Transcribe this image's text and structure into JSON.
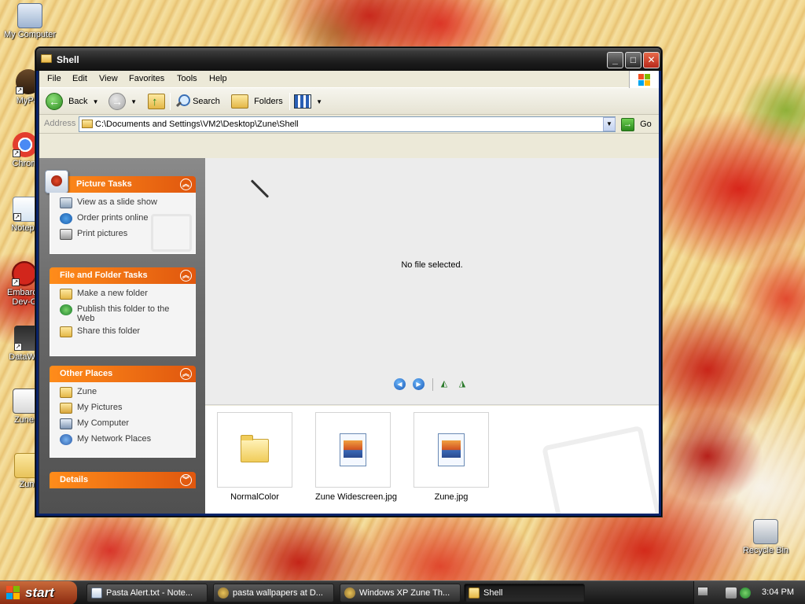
{
  "desktop": {
    "icons": [
      {
        "label": "My Computer"
      },
      {
        "label": "MyPal"
      },
      {
        "label": "Chrom"
      },
      {
        "label": "Notepa"
      },
      {
        "label": "Embarca Dev-C"
      },
      {
        "label": "DataWag"
      },
      {
        "label": "Zune."
      },
      {
        "label": "Zun"
      },
      {
        "label": "Recycle Bin"
      }
    ]
  },
  "window": {
    "title": "Shell",
    "min_label": "_",
    "max_label": "□",
    "close_label": "✕"
  },
  "menu": {
    "items": [
      "File",
      "Edit",
      "View",
      "Favorites",
      "Tools",
      "Help"
    ]
  },
  "toolbar": {
    "back_label": "Back",
    "search_label": "Search",
    "folders_label": "Folders"
  },
  "address": {
    "label": "Address",
    "value": "C:\\Documents and Settings\\VM2\\Desktop\\Zune\\Shell",
    "go_label": "Go"
  },
  "taskpane": {
    "picture_tasks": {
      "title": "Picture Tasks",
      "items": [
        "View as a slide show",
        "Order prints online",
        "Print pictures"
      ]
    },
    "file_folder_tasks": {
      "title": "File and Folder Tasks",
      "items": [
        "Make a new folder",
        "Publish this folder to the Web",
        "Share this folder"
      ]
    },
    "other_places": {
      "title": "Other Places",
      "items": [
        "Zune",
        "My Pictures",
        "My Computer",
        "My Network Places"
      ]
    },
    "details": {
      "title": "Details"
    }
  },
  "preview": {
    "status_text": "No file selected."
  },
  "files": [
    {
      "name": "NormalColor",
      "type": "folder"
    },
    {
      "name": "Zune Widescreen.jpg",
      "type": "image"
    },
    {
      "name": "Zune.jpg",
      "type": "image"
    }
  ],
  "taskbar": {
    "start_label": "start",
    "tasks": [
      {
        "label": "Pasta Alert.txt - Note..."
      },
      {
        "label": "pasta wallpapers at D..."
      },
      {
        "label": "Windows XP Zune Th..."
      },
      {
        "label": "Shell"
      }
    ],
    "clock": "3:04 PM"
  },
  "colors": {
    "taskpane_header": "#e0570e",
    "window_frame": "#1e1e1e"
  }
}
